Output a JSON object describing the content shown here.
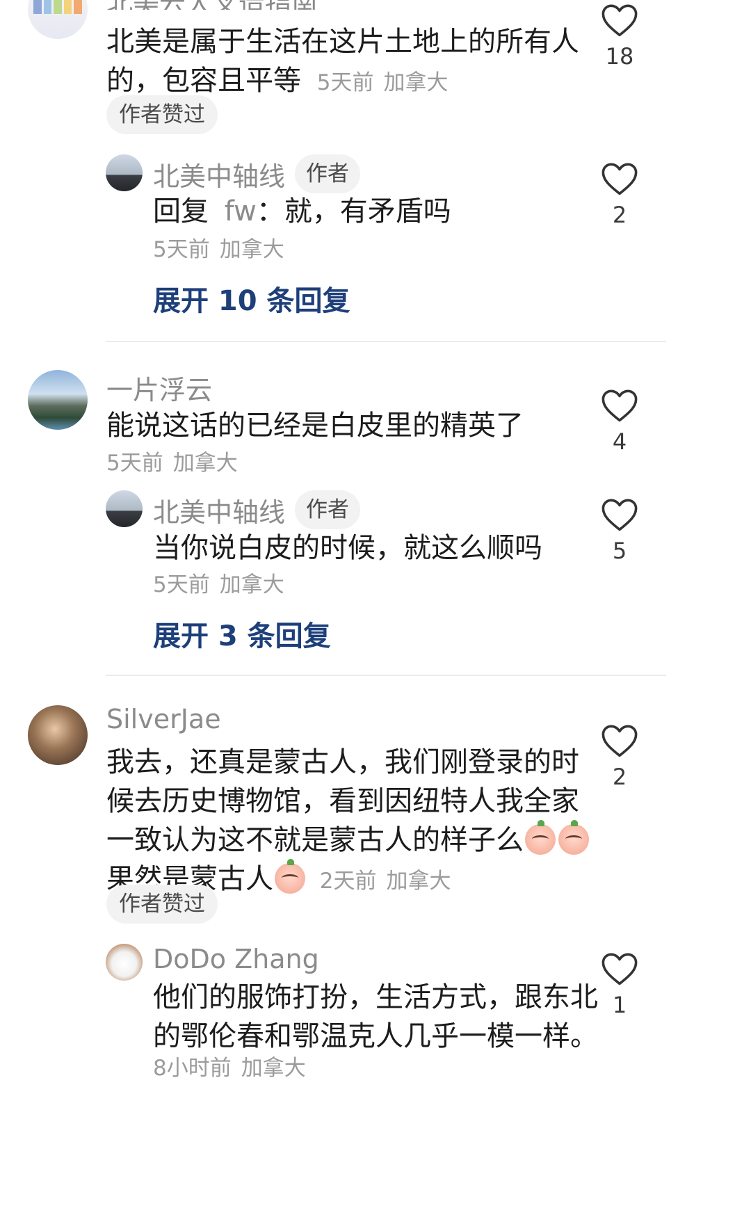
{
  "comments": [
    {
      "username": "北美云大叉造指南",
      "text": "北美是属于生活在这片土地上的所有人的，包容且平等",
      "time": "5天前",
      "location": "加拿大",
      "likes": "18",
      "badge": "作者赞过",
      "reply": {
        "username": "北美中轴线",
        "tag": "作者",
        "text_prefix": "回复",
        "reply_to": "fw",
        "text": "就，有矛盾吗",
        "time": "5天前",
        "location": "加拿大",
        "likes": "2"
      },
      "expand_label": "展开 10 条回复"
    },
    {
      "username": "一片浮云",
      "text": "能说这话的已经是白皮里的精英了",
      "time": "5天前",
      "location": "加拿大",
      "likes": "4",
      "reply": {
        "username": "北美中轴线",
        "tag": "作者",
        "text": "当你说白皮的时候，就这么顺吗",
        "time": "5天前",
        "location": "加拿大",
        "likes": "5"
      },
      "expand_label": "展开 3 条回复"
    },
    {
      "username": "SilverJae",
      "text_lines": [
        "我去，还真是蒙古人，我们刚登录的时",
        "候去历史博物馆，看到因纽特人我全家",
        "一致认为这不就是蒙古人的样子么",
        "果然是蒙古人"
      ],
      "time": "2天前",
      "location": "加拿大",
      "likes": "2",
      "badge": "作者赞过",
      "reply": {
        "username": "DoDo Zhang",
        "text_lines": [
          "他们的服饰打扮，生活方式，跟东北",
          "的鄂伦春和鄂温克人几乎一模一样。"
        ],
        "time": "8小时前",
        "location": "加拿大",
        "likes": "1"
      }
    }
  ],
  "colors": {
    "expand_link": "#1d3f7a",
    "meta_text": "#9b9b9b",
    "username": "#8b8b8b"
  },
  "icons": {
    "like": "heart-outline-icon",
    "emoji": "peach-face-emoji-icon"
  }
}
